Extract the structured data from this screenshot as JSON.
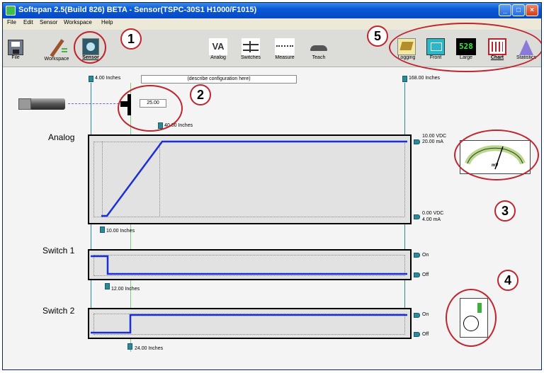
{
  "window": {
    "title": "Softspan 2.5(Build 826) BETA - Sensor(TSPC-30S1 H1000/F1015)"
  },
  "menu": [
    "File",
    "Edit",
    "Sensor",
    "Workspace",
    "Help"
  ],
  "toolbar": {
    "left": [
      {
        "label": "File",
        "icon": "floppy-disk-icon"
      },
      {
        "label": "Workspace",
        "icon": "pencil-icon"
      },
      {
        "label": "Sensor",
        "icon": "sensor-icon"
      }
    ],
    "middle": [
      {
        "label": "Analog",
        "icon": "va-icon",
        "icon_text": "VA"
      },
      {
        "label": "Switches",
        "icon": "switches-icon"
      },
      {
        "label": "Measure",
        "icon": "measure-icon"
      },
      {
        "label": "Teach",
        "icon": "teach-icon"
      }
    ],
    "right": [
      {
        "label": "Logging",
        "icon": "logging-icon"
      },
      {
        "label": "Front",
        "icon": "front-panel-icon"
      },
      {
        "label": "Large",
        "icon": "large-display-icon",
        "icon_text": "528"
      },
      {
        "label": "Chart",
        "icon": "chart-icon"
      },
      {
        "label": "Statistics",
        "icon": "statistics-icon"
      }
    ]
  },
  "config": {
    "left_limit": "4.00 Inches",
    "right_limit": "168.00 Inches",
    "description": "(describe configuration here)",
    "target_value": "25.00",
    "target_position": "40.00 Inches"
  },
  "analog": {
    "label": "Analog",
    "top_voltage": "10.00 VDC",
    "top_current": "20.00 mA",
    "bottom_voltage": "0.00 VDC",
    "bottom_current": "4.00 mA",
    "start_position": "10.00 Inches"
  },
  "switch1": {
    "label": "Switch 1",
    "on": "On",
    "off": "Off",
    "position": "12.00 Inches"
  },
  "switch2": {
    "label": "Switch 2",
    "on": "On",
    "off": "Off",
    "position": "24.00 Inches"
  },
  "meter": {
    "unit": "mV"
  },
  "callouts": [
    "1",
    "2",
    "3",
    "4",
    "5"
  ],
  "colors": {
    "signal": "#1b2fd6",
    "callout": "#c0242c",
    "guide_green": "#7ccf7c",
    "guide_teal": "#2a8a9a"
  }
}
